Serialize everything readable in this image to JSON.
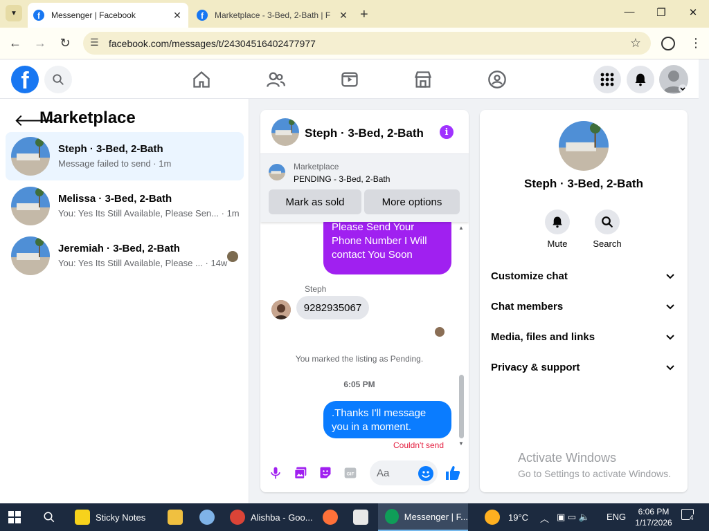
{
  "browser": {
    "tabs": [
      {
        "title": "Messenger | Facebook",
        "active": true
      },
      {
        "title": "Marketplace - 3-Bed, 2-Bath | F",
        "active": false
      }
    ],
    "url": "facebook.com/messages/t/24304516402477977"
  },
  "left_panel": {
    "title": "Marketplace",
    "conversations": [
      {
        "name": "Steph · 3-Bed, 2-Bath",
        "preview": "Message failed to send · 1m",
        "selected": true
      },
      {
        "name": "Melissa · 3-Bed, 2-Bath",
        "preview": "You: Yes Its Still Available, Please Sen...",
        "time": "· 1m",
        "selected": false
      },
      {
        "name": "Jeremiah · 3-Bed, 2-Bath",
        "preview": "You: Yes Its Still Available, Please ...",
        "time": "· 14w",
        "selected": false
      }
    ]
  },
  "chat": {
    "title": "Steph · 3-Bed, 2-Bath",
    "listing_label": "Marketplace",
    "listing_status": "PENDING - 3-Bed, 2-Bath",
    "mark_sold": "Mark as sold",
    "more_options": "More options",
    "outgoing_partial": "Yes Its Still Available, Please Send Your Phone Number I Will contact You Soon",
    "sender": "Steph",
    "incoming": "9282935067",
    "system_msg": "You marked the listing as Pending.",
    "timestamp": "6:05 PM",
    "outgoing": ".Thanks I'll message you in a moment.",
    "error": "Couldn't send",
    "placeholder": "Aa"
  },
  "info_panel": {
    "name": "Steph · 3-Bed, 2-Bath",
    "actions": [
      "Mute",
      "Search"
    ],
    "sections": [
      "Customize chat",
      "Chat members",
      "Media, files and links",
      "Privacy & support"
    ]
  },
  "watermark": {
    "line1": "Activate Windows",
    "line2": "Go to Settings to activate Windows."
  },
  "taskbar": {
    "apps": [
      "Sticky Notes",
      "Alishba - Goo...",
      "Messenger | F..."
    ],
    "weather": "19°C",
    "lang": "ENG",
    "time": "6:06 PM",
    "date": "1/17/2026",
    "notif_count": "4"
  },
  "colors": {
    "fb_blue": "#1877f2",
    "purple": "#a020f0",
    "messenger_blue": "#0a7cff",
    "error_red": "#e41e3f"
  }
}
